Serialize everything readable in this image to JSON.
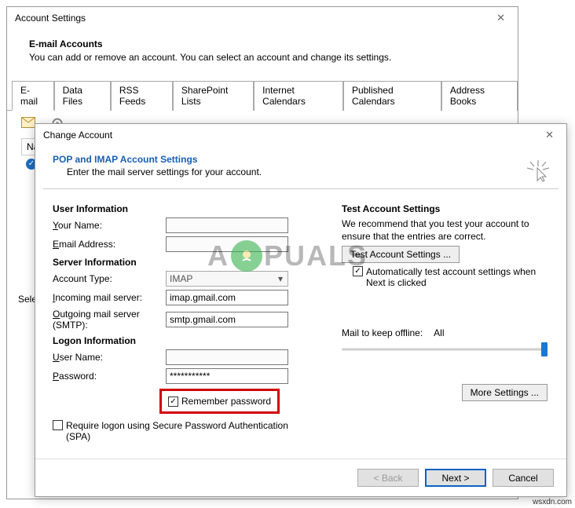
{
  "back": {
    "title": "Account Settings",
    "intro_h": "E-mail Accounts",
    "intro_text": "You can add or remove an account. You can select an account and change its settings.",
    "tabs": [
      "E-mail",
      "Data Files",
      "RSS Feeds",
      "SharePoint Lists",
      "Internet Calendars",
      "Published Calendars",
      "Address Books"
    ],
    "header_na": "Na",
    "sele": "Sele"
  },
  "front": {
    "title": "Change Account",
    "head_h": "POP and IMAP Account Settings",
    "head_sub": "Enter the mail server settings for your account.",
    "sect_user": "User Information",
    "lbl_yourname": "Your Name:",
    "lbl_email": "Email Address:",
    "sect_server": "Server Information",
    "lbl_accttype": "Account Type:",
    "val_accttype": "IMAP",
    "lbl_incoming": "Incoming mail server:",
    "val_incoming": "imap.gmail.com",
    "lbl_outgoing": "Outgoing mail server (SMTP):",
    "val_outgoing": "smtp.gmail.com",
    "sect_logon": "Logon Information",
    "lbl_username": "User Name:",
    "lbl_password": "Password:",
    "val_password": "***********",
    "remember": "Remember password",
    "spa": "Require logon using Secure Password Authentication (SPA)",
    "test_h": "Test Account Settings",
    "test_desc": "We recommend that you test your account to ensure that the entries are correct.",
    "test_btn": "Test Account Settings ...",
    "autotest": "Automatically test account settings when Next is clicked",
    "slider_label": "Mail to keep offline:",
    "slider_value": "All",
    "more_btn": "More Settings ...",
    "wiz_back": "< Back",
    "wiz_next": "Next >",
    "wiz_cancel": "Cancel"
  },
  "watermark": {
    "pre": "A",
    "post": "PUALS"
  },
  "credit": "wsxdn.com"
}
